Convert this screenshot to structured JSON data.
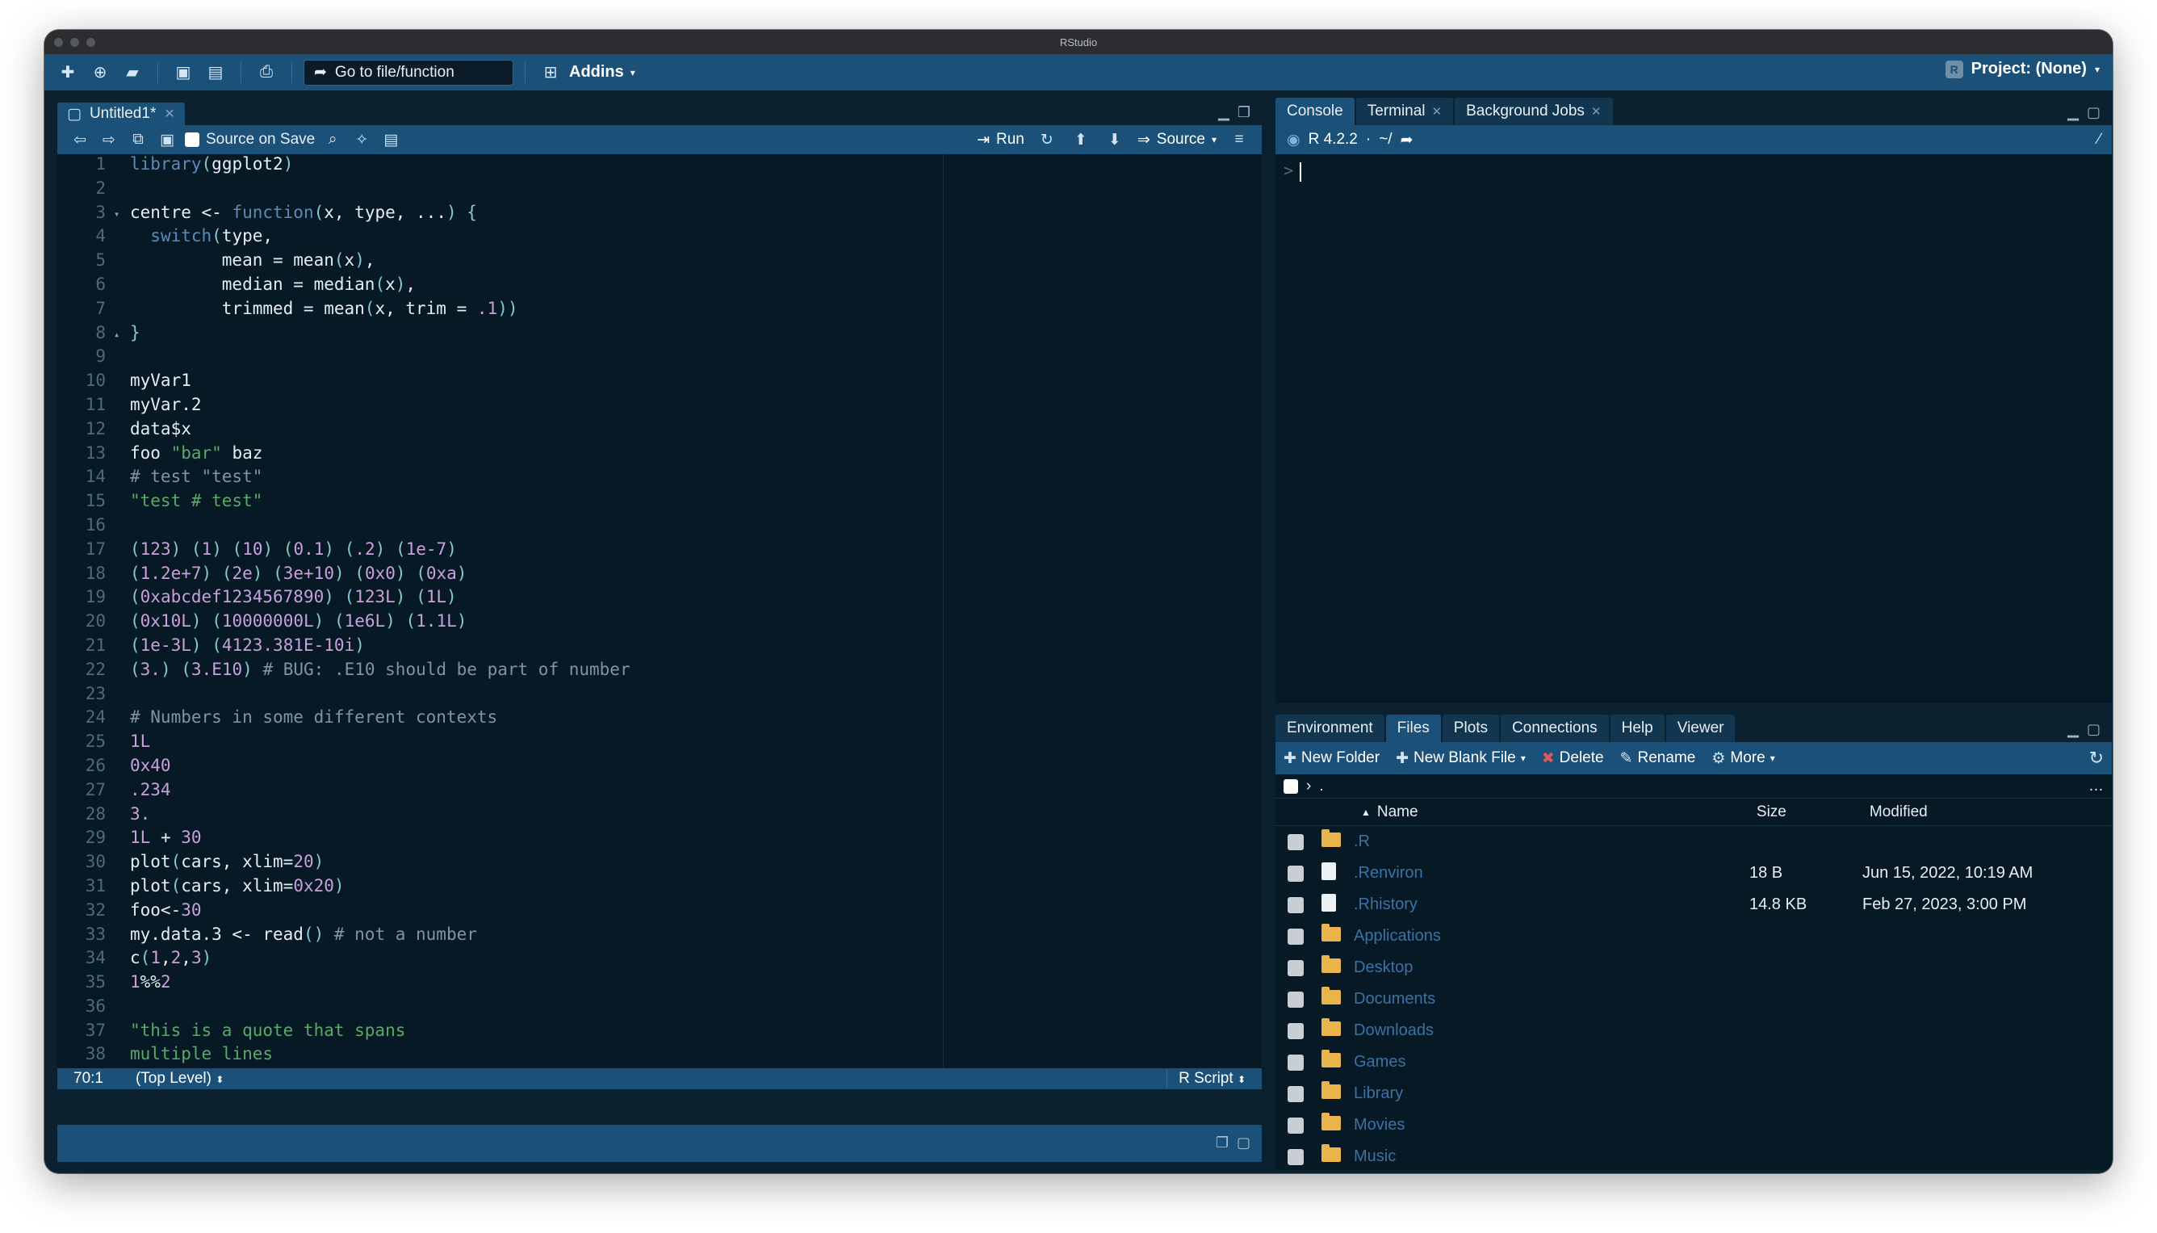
{
  "window": {
    "title": "RStudio"
  },
  "toolbar": {
    "goto_placeholder": "Go to file/function",
    "addins_label": "Addins",
    "project_label": "Project: (None)"
  },
  "editor": {
    "tab_label": "Untitled1*",
    "source_on_save": "Source on Save",
    "run_label": "Run",
    "source_label": "Source",
    "lines": [
      [
        {
          "t": "library",
          "c": "kw"
        },
        {
          "t": "(",
          "c": "br"
        },
        {
          "t": "ggplot2",
          "c": ""
        },
        {
          "t": ")",
          "c": "br"
        }
      ],
      [],
      [
        {
          "t": "centre <- ",
          "c": ""
        },
        {
          "t": "function",
          "c": "kw"
        },
        {
          "t": "(",
          "c": "br"
        },
        {
          "t": "x, type, ...",
          "c": ""
        },
        {
          "t": ")",
          "c": "br"
        },
        {
          "t": " ",
          "c": ""
        },
        {
          "t": "{",
          "c": "br"
        }
      ],
      [
        {
          "t": "  ",
          "c": ""
        },
        {
          "t": "switch",
          "c": "kw"
        },
        {
          "t": "(",
          "c": "br"
        },
        {
          "t": "type,",
          "c": ""
        }
      ],
      [
        {
          "t": "         mean = mean",
          "c": ""
        },
        {
          "t": "(",
          "c": "br"
        },
        {
          "t": "x",
          "c": ""
        },
        {
          "t": ")",
          "c": "br"
        },
        {
          "t": ",",
          "c": ""
        }
      ],
      [
        {
          "t": "         median = median",
          "c": ""
        },
        {
          "t": "(",
          "c": "br"
        },
        {
          "t": "x",
          "c": ""
        },
        {
          "t": ")",
          "c": "br"
        },
        {
          "t": ",",
          "c": ""
        }
      ],
      [
        {
          "t": "         trimmed = mean",
          "c": ""
        },
        {
          "t": "(",
          "c": "br"
        },
        {
          "t": "x, trim = ",
          "c": ""
        },
        {
          "t": ".1",
          "c": "num"
        },
        {
          "t": "))",
          "c": "br"
        }
      ],
      [
        {
          "t": "}",
          "c": "br"
        }
      ],
      [],
      [
        {
          "t": "myVar1",
          "c": ""
        }
      ],
      [
        {
          "t": "myVar.2",
          "c": ""
        }
      ],
      [
        {
          "t": "data$x",
          "c": ""
        }
      ],
      [
        {
          "t": "foo ",
          "c": ""
        },
        {
          "t": "\"bar\"",
          "c": "str"
        },
        {
          "t": " baz",
          "c": ""
        }
      ],
      [
        {
          "t": "# test \"test\"",
          "c": "com"
        }
      ],
      [
        {
          "t": "\"test # test\"",
          "c": "str"
        }
      ],
      [],
      [
        {
          "t": "(",
          "c": "br"
        },
        {
          "t": "123",
          "c": "num"
        },
        {
          "t": ")",
          "c": "br"
        },
        {
          "t": " ",
          "c": ""
        },
        {
          "t": "(",
          "c": "br"
        },
        {
          "t": "1",
          "c": "num"
        },
        {
          "t": ")",
          "c": "br"
        },
        {
          "t": " ",
          "c": ""
        },
        {
          "t": "(",
          "c": "br"
        },
        {
          "t": "10",
          "c": "num"
        },
        {
          "t": ")",
          "c": "br"
        },
        {
          "t": " ",
          "c": ""
        },
        {
          "t": "(",
          "c": "br"
        },
        {
          "t": "0.1",
          "c": "num"
        },
        {
          "t": ")",
          "c": "br"
        },
        {
          "t": " ",
          "c": ""
        },
        {
          "t": "(",
          "c": "br"
        },
        {
          "t": ".2",
          "c": "num"
        },
        {
          "t": ")",
          "c": "br"
        },
        {
          "t": " ",
          "c": ""
        },
        {
          "t": "(",
          "c": "br"
        },
        {
          "t": "1e-7",
          "c": "num"
        },
        {
          "t": ")",
          "c": "br"
        }
      ],
      [
        {
          "t": "(",
          "c": "br"
        },
        {
          "t": "1.2e+7",
          "c": "num"
        },
        {
          "t": ")",
          "c": "br"
        },
        {
          "t": " ",
          "c": ""
        },
        {
          "t": "(",
          "c": "br"
        },
        {
          "t": "2e",
          "c": "num"
        },
        {
          "t": ")",
          "c": "br"
        },
        {
          "t": " ",
          "c": ""
        },
        {
          "t": "(",
          "c": "br"
        },
        {
          "t": "3e+10",
          "c": "num"
        },
        {
          "t": ")",
          "c": "br"
        },
        {
          "t": " ",
          "c": ""
        },
        {
          "t": "(",
          "c": "br"
        },
        {
          "t": "0x0",
          "c": "num"
        },
        {
          "t": ")",
          "c": "br"
        },
        {
          "t": " ",
          "c": ""
        },
        {
          "t": "(",
          "c": "br"
        },
        {
          "t": "0xa",
          "c": "num"
        },
        {
          "t": ")",
          "c": "br"
        }
      ],
      [
        {
          "t": "(",
          "c": "br"
        },
        {
          "t": "0xabcdef1234567890",
          "c": "num"
        },
        {
          "t": ")",
          "c": "br"
        },
        {
          "t": " ",
          "c": ""
        },
        {
          "t": "(",
          "c": "br"
        },
        {
          "t": "123L",
          "c": "num"
        },
        {
          "t": ")",
          "c": "br"
        },
        {
          "t": " ",
          "c": ""
        },
        {
          "t": "(",
          "c": "br"
        },
        {
          "t": "1L",
          "c": "num"
        },
        {
          "t": ")",
          "c": "br"
        }
      ],
      [
        {
          "t": "(",
          "c": "br"
        },
        {
          "t": "0x10L",
          "c": "num"
        },
        {
          "t": ")",
          "c": "br"
        },
        {
          "t": " ",
          "c": ""
        },
        {
          "t": "(",
          "c": "br"
        },
        {
          "t": "10000000L",
          "c": "num"
        },
        {
          "t": ")",
          "c": "br"
        },
        {
          "t": " ",
          "c": ""
        },
        {
          "t": "(",
          "c": "br"
        },
        {
          "t": "1e6L",
          "c": "num"
        },
        {
          "t": ")",
          "c": "br"
        },
        {
          "t": " ",
          "c": ""
        },
        {
          "t": "(",
          "c": "br"
        },
        {
          "t": "1.1L",
          "c": "num"
        },
        {
          "t": ")",
          "c": "br"
        }
      ],
      [
        {
          "t": "(",
          "c": "br"
        },
        {
          "t": "1e-3L",
          "c": "num"
        },
        {
          "t": ")",
          "c": "br"
        },
        {
          "t": " ",
          "c": ""
        },
        {
          "t": "(",
          "c": "br"
        },
        {
          "t": "4123.381E-10i",
          "c": "num"
        },
        {
          "t": ")",
          "c": "br"
        }
      ],
      [
        {
          "t": "(",
          "c": "br"
        },
        {
          "t": "3.",
          "c": "num"
        },
        {
          "t": ")",
          "c": "br"
        },
        {
          "t": " ",
          "c": ""
        },
        {
          "t": "(",
          "c": "br"
        },
        {
          "t": "3.E10",
          "c": "num"
        },
        {
          "t": ")",
          "c": "br"
        },
        {
          "t": " # BUG: .E10 should be part of number",
          "c": "com"
        }
      ],
      [],
      [
        {
          "t": "# Numbers in some different contexts",
          "c": "com"
        }
      ],
      [
        {
          "t": "1L",
          "c": "num"
        }
      ],
      [
        {
          "t": "0x40",
          "c": "num"
        }
      ],
      [
        {
          "t": ".234",
          "c": "num"
        }
      ],
      [
        {
          "t": "3.",
          "c": "num"
        }
      ],
      [
        {
          "t": "1L",
          "c": "num"
        },
        {
          "t": " + ",
          "c": ""
        },
        {
          "t": "30",
          "c": "num"
        }
      ],
      [
        {
          "t": "plot",
          "c": ""
        },
        {
          "t": "(",
          "c": "br"
        },
        {
          "t": "cars, xlim=",
          "c": ""
        },
        {
          "t": "20",
          "c": "num"
        },
        {
          "t": ")",
          "c": "br"
        }
      ],
      [
        {
          "t": "plot",
          "c": ""
        },
        {
          "t": "(",
          "c": "br"
        },
        {
          "t": "cars, xlim=",
          "c": ""
        },
        {
          "t": "0x20",
          "c": "num"
        },
        {
          "t": ")",
          "c": "br"
        }
      ],
      [
        {
          "t": "foo<-",
          "c": ""
        },
        {
          "t": "30",
          "c": "num"
        }
      ],
      [
        {
          "t": "my.data.3 <- read",
          "c": ""
        },
        {
          "t": "()",
          "c": "br"
        },
        {
          "t": " # not a number",
          "c": "com"
        }
      ],
      [
        {
          "t": "c",
          "c": ""
        },
        {
          "t": "(",
          "c": "br"
        },
        {
          "t": "1",
          "c": "num"
        },
        {
          "t": ",",
          "c": ""
        },
        {
          "t": "2",
          "c": "num"
        },
        {
          "t": ",",
          "c": ""
        },
        {
          "t": "3",
          "c": "num"
        },
        {
          "t": ")",
          "c": "br"
        }
      ],
      [
        {
          "t": "1",
          "c": "num"
        },
        {
          "t": "%%",
          "c": ""
        },
        {
          "t": "2",
          "c": "num"
        }
      ],
      [],
      [
        {
          "t": "\"this is a quote that spans",
          "c": "str"
        }
      ],
      [
        {
          "t": "multiple lines",
          "c": "str"
        }
      ],
      [
        {
          "t": "\\\"",
          "c": "str"
        }
      ]
    ],
    "folds": {
      "3": "▾",
      "8": "▴"
    },
    "status_position": "70:1",
    "status_scope": "(Top Level)",
    "status_type": "R Script"
  },
  "console": {
    "tabs": [
      "Console",
      "Terminal",
      "Background Jobs"
    ],
    "r_version": "R 4.2.2",
    "path": "~/",
    "prompt": ">"
  },
  "files": {
    "tabs": [
      "Environment",
      "Files",
      "Plots",
      "Connections",
      "Help",
      "Viewer"
    ],
    "active_tab": 1,
    "toolbar": {
      "new_folder": "New Folder",
      "new_blank_file": "New Blank File",
      "delete": "Delete",
      "rename": "Rename",
      "more": "More"
    },
    "path": ".",
    "columns": {
      "name": "Name",
      "size": "Size",
      "modified": "Modified"
    },
    "rows": [
      {
        "name": ".R",
        "size": "",
        "modified": "",
        "kind": "folder"
      },
      {
        "name": ".Renviron",
        "size": "18 B",
        "modified": "Jun 15, 2022, 10:19 AM",
        "kind": "file"
      },
      {
        "name": ".Rhistory",
        "size": "14.8 KB",
        "modified": "Feb 27, 2023, 3:00 PM",
        "kind": "file"
      },
      {
        "name": "Applications",
        "size": "",
        "modified": "",
        "kind": "folder"
      },
      {
        "name": "Desktop",
        "size": "",
        "modified": "",
        "kind": "folder"
      },
      {
        "name": "Documents",
        "size": "",
        "modified": "",
        "kind": "folder"
      },
      {
        "name": "Downloads",
        "size": "",
        "modified": "",
        "kind": "folder"
      },
      {
        "name": "Games",
        "size": "",
        "modified": "",
        "kind": "folder"
      },
      {
        "name": "Library",
        "size": "",
        "modified": "",
        "kind": "folder"
      },
      {
        "name": "Movies",
        "size": "",
        "modified": "",
        "kind": "folder"
      },
      {
        "name": "Music",
        "size": "",
        "modified": "",
        "kind": "folder"
      }
    ]
  },
  "colors": {
    "accent": "#1b5079",
    "background": "#061924",
    "link": "#3b72a6"
  }
}
